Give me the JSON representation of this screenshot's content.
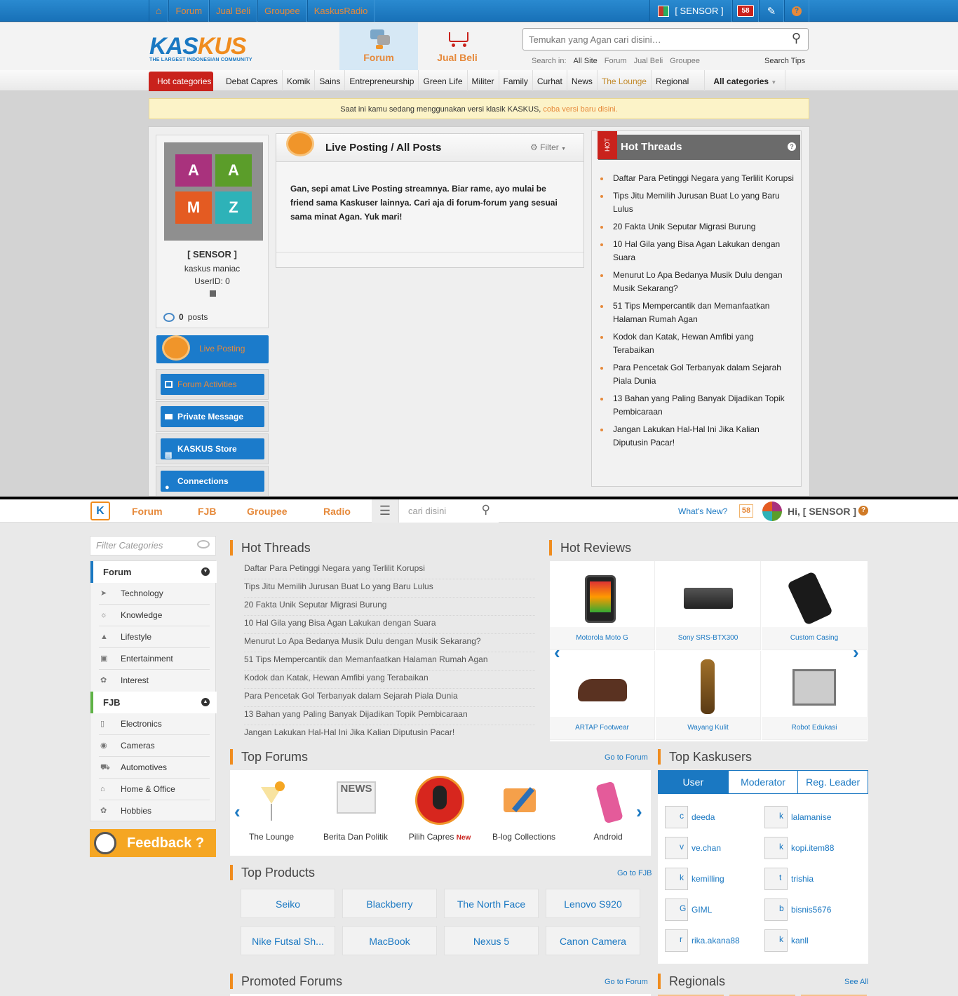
{
  "classic": {
    "topbar": {
      "nav": [
        "Forum",
        "Jual Beli",
        "Groupee",
        "KaskusRadio"
      ],
      "username": "[ SENSOR ]",
      "notif_count": "58",
      "icons": [
        "home-icon",
        "edit-icon",
        "help-icon"
      ]
    },
    "logo": {
      "text_a": "KAS",
      "text_b": "KUS",
      "tagline": "THE LARGEST INDONESIAN COMMUNITY"
    },
    "header_tabs": [
      {
        "label": "Forum"
      },
      {
        "label": "Jual Beli"
      }
    ],
    "search": {
      "placeholder": "Temukan yang Agan cari disini…",
      "search_in_label": "Search in:",
      "options": [
        "All Site",
        "Forum",
        "Jual Beli",
        "Groupee"
      ],
      "tips": "Search Tips"
    },
    "categories": {
      "hot": "Hot categories",
      "items": [
        "Debat Capres",
        "Komik",
        "Sains",
        "Entrepreneurship",
        "Green Life",
        "Militer",
        "Family",
        "Curhat",
        "News",
        "The Lounge",
        "Regional"
      ],
      "all": "All categories"
    },
    "notice": {
      "text": "Saat ini kamu sedang menggunakan versi klasik KASKUS,",
      "link": "coba versi baru disini."
    },
    "profile": {
      "name": "[ SENSOR ]",
      "rank": "kaskus maniac",
      "userid": "UserID: 0",
      "posts_count": "0",
      "posts_label": "posts"
    },
    "side_buttons": [
      "Live Posting",
      "Forum Activities",
      "Private Message",
      "KASKUS Store",
      "Connections"
    ],
    "live": {
      "title": "Live Posting / All Posts",
      "filter": "Filter",
      "message": "Gan, sepi amat Live Posting streamnya. Biar rame, ayo mulai be friend sama Kaskuser lainnya. Cari aja di forum-forum yang sesuai sama minat Agan. Yuk mari!"
    },
    "hot_threads": {
      "flag": "HOT",
      "title": "Hot Threads",
      "items": [
        "Daftar Para Petinggi Negara yang Terlilit Korupsi",
        "Tips Jitu Memilih Jurusan Buat Lo yang Baru Lulus",
        "20 Fakta Unik Seputar Migrasi Burung",
        "10 Hal Gila yang Bisa Agan Lakukan dengan Suara",
        "Menurut Lo Apa Bedanya Musik Dulu dengan Musik Sekarang?",
        "51 Tips Mempercantik dan Memanfaatkan Halaman Rumah Agan",
        "Kodok dan Katak, Hewan Amfibi yang Terabaikan",
        "Para Pencetak Gol Terbanyak dalam Sejarah Piala Dunia",
        "13 Bahan yang Paling Banyak Dijadikan Topik Pembicaraan",
        "Jangan Lakukan Hal-Hal Ini Jika Kalian Diputusin Pacar!"
      ]
    }
  },
  "modern": {
    "nav": {
      "logo": "K",
      "items": [
        "Forum",
        "FJB",
        "Groupee",
        "Radio"
      ],
      "search_placeholder": "cari disini",
      "whats_new": "What's New?",
      "notif_count": "58",
      "greeting": "Hi, [ SENSOR ]"
    },
    "filter_placeholder": "Filter Categories",
    "categories": {
      "forum": {
        "title": "Forum",
        "items": [
          "Technology",
          "Knowledge",
          "Lifestyle",
          "Entertainment",
          "Interest"
        ]
      },
      "fjb": {
        "title": "FJB",
        "items": [
          "Electronics",
          "Cameras",
          "Automotives",
          "Home & Office",
          "Hobbies"
        ]
      }
    },
    "feedback": "Feedback ?",
    "hot_threads": {
      "title": "Hot Threads",
      "items": [
        "Daftar Para Petinggi Negara yang Terlilit Korupsi",
        "Tips Jitu Memilih Jurusan Buat Lo yang Baru Lulus",
        "20 Fakta Unik Seputar Migrasi Burung",
        "10 Hal Gila yang Bisa Agan Lakukan dengan Suara",
        "Menurut Lo Apa Bedanya Musik Dulu dengan Musik Sekarang?",
        "51 Tips Mempercantik dan Memanfaatkan Halaman Rumah Agan",
        "Kodok dan Katak, Hewan Amfibi yang Terabaikan",
        "Para Pencetak Gol Terbanyak dalam Sejarah Piala Dunia",
        "13 Bahan yang Paling Banyak Dijadikan Topik Pembicaraan",
        "Jangan Lakukan Hal-Hal Ini Jika Kalian Diputusin Pacar!"
      ]
    },
    "hot_reviews": {
      "title": "Hot Reviews",
      "items": [
        "Motorola Moto G",
        "Sony SRS-BTX300",
        "Custom Casing",
        "ARTAP Footwear",
        "Wayang Kulit",
        "Robot Edukasi"
      ]
    },
    "top_forums": {
      "title": "Top Forums",
      "goto": "Go to Forum",
      "items": [
        "The Lounge",
        "Berita Dan Politik",
        "Pilih Capres",
        "B-log Collections",
        "Android"
      ],
      "new_label": "New"
    },
    "top_kaskusers": {
      "title": "Top Kaskusers",
      "tabs": [
        "User",
        "Moderator",
        "Reg. Leader"
      ],
      "users": [
        {
          "initial": "c",
          "name": "deeda"
        },
        {
          "initial": "k",
          "name": "lalamanise"
        },
        {
          "initial": "v",
          "name": "ve.chan"
        },
        {
          "initial": "k",
          "name": "kopi.item88"
        },
        {
          "initial": "k",
          "name": "kemilling"
        },
        {
          "initial": "t",
          "name": "trishia"
        },
        {
          "initial": "G",
          "name": "GIML"
        },
        {
          "initial": "b",
          "name": "bisnis5676"
        },
        {
          "initial": "r",
          "name": "rika.akana88"
        },
        {
          "initial": "k",
          "name": "kanll"
        }
      ]
    },
    "top_products": {
      "title": "Top Products",
      "goto": "Go to FJB",
      "items": [
        "Seiko",
        "Blackberry",
        "The North Face",
        "Lenovo S920",
        "Nike Futsal Sh...",
        "MacBook",
        "Nexus 5",
        "Canon Camera"
      ]
    },
    "promoted_forums": {
      "title": "Promoted Forums",
      "goto": "Go to Forum"
    },
    "regionals": {
      "title": "Regionals",
      "see_all": "See All"
    }
  }
}
